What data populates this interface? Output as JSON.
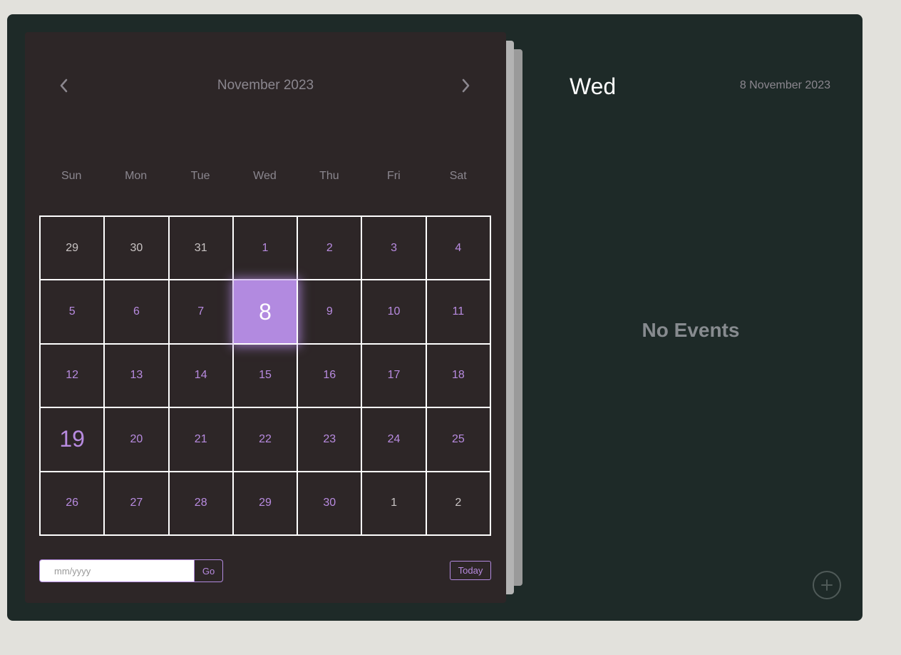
{
  "calendar": {
    "month_title": "November 2023",
    "weekdays": [
      "Sun",
      "Mon",
      "Tue",
      "Wed",
      "Thu",
      "Fri",
      "Sat"
    ],
    "days": [
      {
        "label": "29",
        "state": "other"
      },
      {
        "label": "30",
        "state": "other"
      },
      {
        "label": "31",
        "state": "other"
      },
      {
        "label": "1",
        "state": "current"
      },
      {
        "label": "2",
        "state": "current"
      },
      {
        "label": "3",
        "state": "current"
      },
      {
        "label": "4",
        "state": "current"
      },
      {
        "label": "5",
        "state": "current"
      },
      {
        "label": "6",
        "state": "current"
      },
      {
        "label": "7",
        "state": "current"
      },
      {
        "label": "8",
        "state": "active"
      },
      {
        "label": "9",
        "state": "current"
      },
      {
        "label": "10",
        "state": "current"
      },
      {
        "label": "11",
        "state": "current"
      },
      {
        "label": "12",
        "state": "current"
      },
      {
        "label": "13",
        "state": "current"
      },
      {
        "label": "14",
        "state": "current"
      },
      {
        "label": "15",
        "state": "current"
      },
      {
        "label": "16",
        "state": "current"
      },
      {
        "label": "17",
        "state": "current"
      },
      {
        "label": "18",
        "state": "current"
      },
      {
        "label": "19",
        "state": "today"
      },
      {
        "label": "20",
        "state": "current"
      },
      {
        "label": "21",
        "state": "current"
      },
      {
        "label": "22",
        "state": "current"
      },
      {
        "label": "23",
        "state": "current"
      },
      {
        "label": "24",
        "state": "current"
      },
      {
        "label": "25",
        "state": "current"
      },
      {
        "label": "26",
        "state": "current"
      },
      {
        "label": "27",
        "state": "current"
      },
      {
        "label": "28",
        "state": "current"
      },
      {
        "label": "29",
        "state": "current"
      },
      {
        "label": "30",
        "state": "current"
      },
      {
        "label": "1",
        "state": "other"
      },
      {
        "label": "2",
        "state": "other"
      }
    ],
    "goto_placeholder": "mm/yyyy",
    "goto_value": "",
    "go_label": "Go",
    "today_label": "Today",
    "prev_icon": "chevron-left-icon",
    "next_icon": "chevron-right-icon"
  },
  "events_panel": {
    "day_name": "Wed",
    "date": "8 November 2023",
    "empty_text": "No Events",
    "add_icon": "plus-icon"
  },
  "colors": {
    "accent": "#b28ae0",
    "app_background": "#1e2a28",
    "calendar_background": "#2d2627",
    "page_background": "#e2e1dc"
  }
}
